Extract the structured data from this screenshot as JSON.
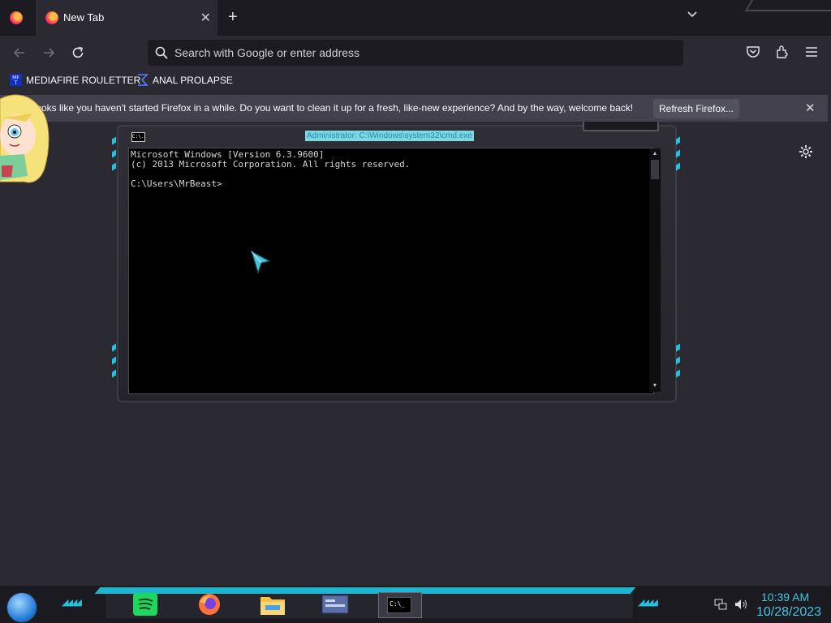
{
  "browser": {
    "tab_title": "New Tab",
    "new_tab_symbol": "+",
    "tab_close_symbol": "✕",
    "urlbar_placeholder": "Search with Google or enter address"
  },
  "bookmarks": [
    {
      "label": "MEDIAFIRE ROULETTER",
      "icon": "mediafire-icon",
      "fav_text": "MF\nT"
    },
    {
      "label": "ANAL PROLAPSE",
      "icon": "sigma-icon"
    }
  ],
  "notification": {
    "message": "t looks like you haven't started Firefox in a while. Do you want to clean it up for a fresh, like-new experience? And by the way, welcome back!",
    "button": "Refresh Firefox...",
    "close": "✕"
  },
  "cmd": {
    "icon_text": "C:\\.",
    "title": "Administrator: C:\\Windows\\system32\\cmd.exe",
    "lines": "Microsoft Windows [Version 6.3.9600]\n(c) 2013 Microsoft Corporation. All rights reserved.\n\nC:\\Users\\MrBeast>"
  },
  "taskbar": {
    "time": "10:39 AM",
    "date": "10/28/2023",
    "apps": [
      "spotify-icon",
      "firefox-icon",
      "file-explorer-icon",
      "control-panel-icon",
      "cmd-icon"
    ],
    "active_icon_text": "C:\\_"
  },
  "colors": {
    "accent_cyan": "#21c4e0",
    "browser_bg": "#2b2a33",
    "tab_strip": "#1c1b22"
  }
}
